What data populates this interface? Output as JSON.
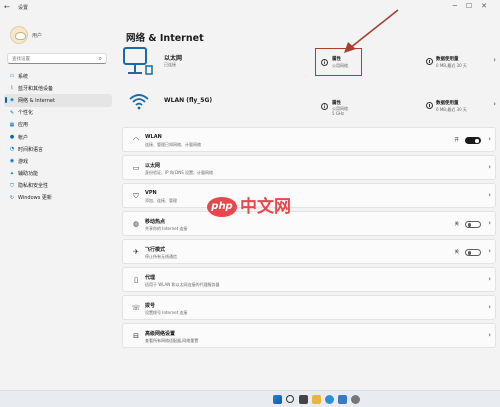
{
  "window": {
    "back_glyph": "←",
    "app_title": "设置",
    "controls": [
      "─",
      "☐",
      "✕"
    ]
  },
  "sidebar": {
    "user_name": "用户",
    "search_placeholder": "查找设置",
    "items": [
      {
        "label": "系统",
        "icon": "monitor-icon",
        "glyph": "▭"
      },
      {
        "label": "蓝牙和其他设备",
        "icon": "bluetooth-icon",
        "glyph": "ᛒ"
      },
      {
        "label": "网络 & Internet",
        "icon": "network-icon",
        "glyph": "◈",
        "active": true
      },
      {
        "label": "个性化",
        "icon": "brush-icon",
        "glyph": "✎"
      },
      {
        "label": "应用",
        "icon": "apps-icon",
        "glyph": "▦"
      },
      {
        "label": "帐户",
        "icon": "person-icon",
        "glyph": "●"
      },
      {
        "label": "时间和语言",
        "icon": "globe-icon",
        "glyph": "◔"
      },
      {
        "label": "游戏",
        "icon": "gamepad-icon",
        "glyph": "◉"
      },
      {
        "label": "辅助功能",
        "icon": "accessibility-icon",
        "glyph": "✦"
      },
      {
        "label": "隐私和安全性",
        "icon": "shield-icon",
        "glyph": "⛉"
      },
      {
        "label": "Windows 更新",
        "icon": "update-icon",
        "glyph": "↻"
      }
    ]
  },
  "content": {
    "title": "网络 & Internet",
    "ethernet": {
      "name": "以太网",
      "status": "已连接",
      "properties_label": "属性",
      "properties_sub": "公用网络",
      "usage_label": "数据使用量",
      "usage_sub": "0 MB,最近 30 天"
    },
    "wlan": {
      "name": "WLAN (fly_5G)",
      "properties_label": "属性",
      "properties_sub": "公用网络\n5 GHz",
      "usage_label": "数据使用量",
      "usage_sub": "0 MB,最近 30 天"
    },
    "cards": [
      {
        "title": "WLAN",
        "sub": "连接、管理已知网络、计量网络",
        "icon": "wifi-icon",
        "glyph": "◠",
        "state": "开",
        "toggle": "on"
      },
      {
        "title": "以太网",
        "sub": "身份验证、IP 和 DNS 设置、计量网络",
        "icon": "ethernet-icon",
        "glyph": "▭"
      },
      {
        "title": "VPN",
        "sub": "添加、连接、管理",
        "icon": "vpn-icon",
        "glyph": "⛉"
      },
      {
        "title": "移动热点",
        "sub": "共享你的 Internet 连接",
        "icon": "hotspot-icon",
        "glyph": "◍",
        "state": "关",
        "toggle": "off"
      },
      {
        "title": "飞行模式",
        "sub": "停止所有无线通信",
        "icon": "airplane-icon",
        "glyph": "✈",
        "state": "关",
        "toggle": "off"
      },
      {
        "title": "代理",
        "sub": "适用于 WLAN 和以太网连接的代理服务器",
        "icon": "proxy-icon",
        "glyph": "▯"
      },
      {
        "title": "拨号",
        "sub": "设置拨号 Internet 连接",
        "icon": "dialup-icon",
        "glyph": "☏"
      },
      {
        "title": "高级网络设置",
        "sub": "查看所有网络适配器,网络重置",
        "icon": "advanced-network-icon",
        "glyph": "⊟"
      }
    ]
  },
  "watermark": {
    "oval_text": "php",
    "text": "中文网"
  },
  "colors": {
    "accent": "#0067c0",
    "highlight": "#a93f2c",
    "watermark": "#e8474d"
  }
}
